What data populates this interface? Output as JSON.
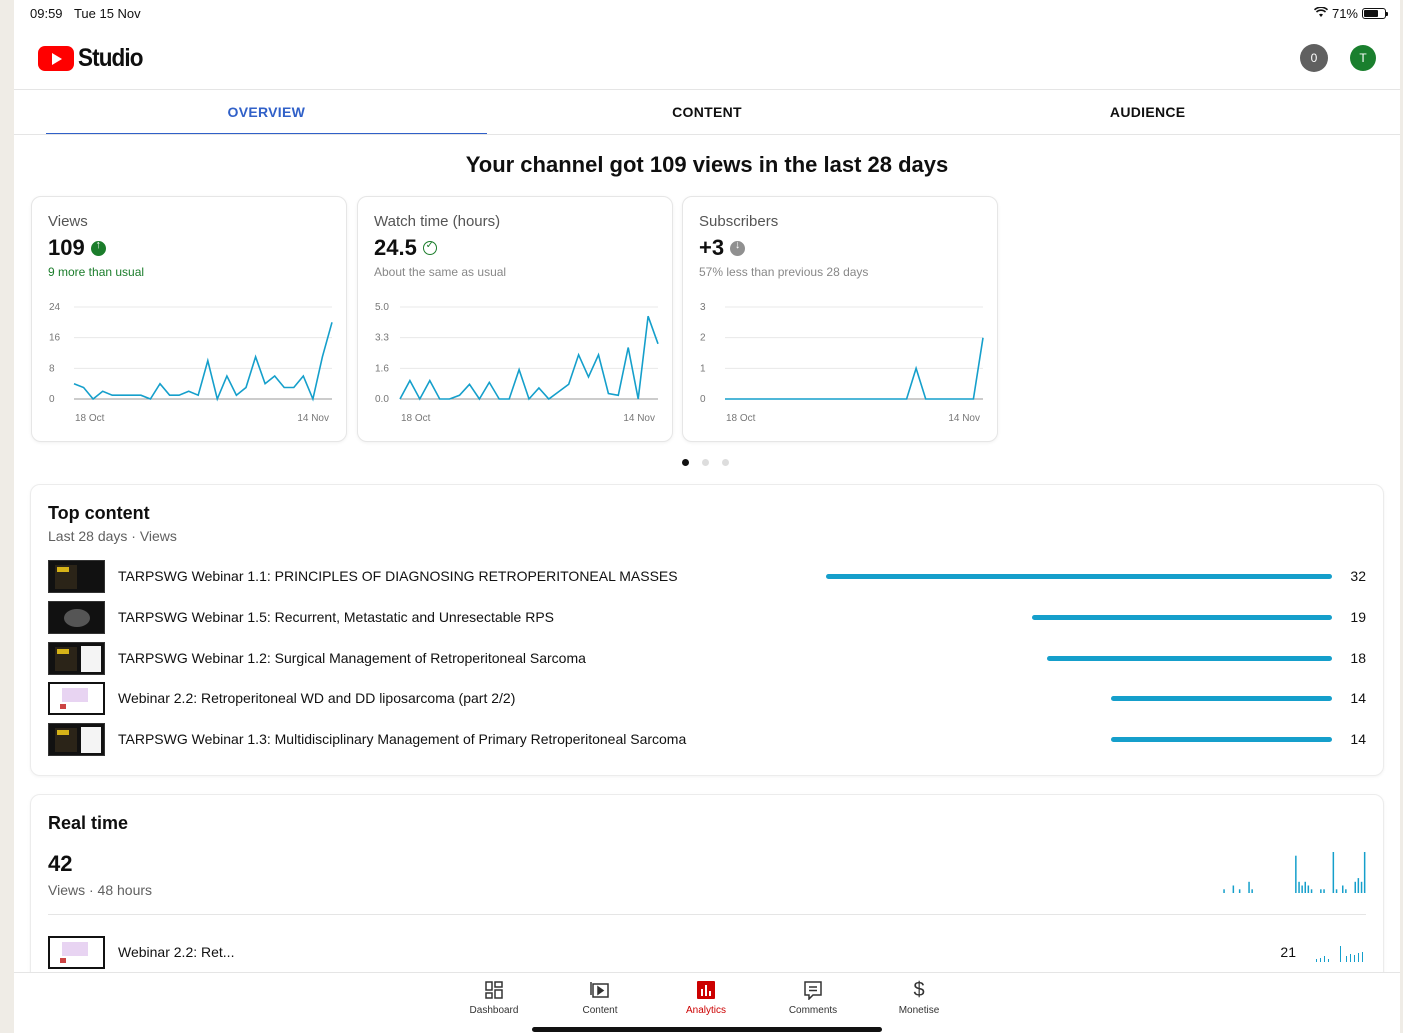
{
  "status_bar": {
    "time": "09:59",
    "date": "Tue 15 Nov",
    "battery": "71%"
  },
  "header": {
    "app_name": "Studio",
    "notification_count": "0",
    "avatar_initial": "T"
  },
  "tabs": [
    {
      "label": "OVERVIEW",
      "active": true
    },
    {
      "label": "CONTENT",
      "active": false
    },
    {
      "label": "AUDIENCE",
      "active": false
    }
  ],
  "headline": "Your channel got 109 views in the last 28 days",
  "metrics": [
    {
      "title": "Views",
      "value": "109",
      "trend": "up",
      "note": "9 more than usual",
      "chart_data": {
        "type": "line",
        "x_labels": [
          "18 Oct",
          "14 Nov"
        ],
        "y_ticks": [
          "24",
          "16",
          "8",
          "0"
        ],
        "ylim": [
          0,
          24
        ],
        "values": [
          4,
          3,
          0,
          2,
          1,
          1,
          1,
          1,
          0,
          4,
          1,
          1,
          2,
          1,
          10,
          0,
          6,
          1,
          3,
          11,
          4,
          6,
          3,
          3,
          6,
          0,
          11,
          20
        ]
      }
    },
    {
      "title": "Watch time (hours)",
      "value": "24.5",
      "trend": "same",
      "note": "About the same as usual",
      "chart_data": {
        "type": "line",
        "x_labels": [
          "18 Oct",
          "14 Nov"
        ],
        "y_ticks": [
          "5.0",
          "3.3",
          "1.6",
          "0.0"
        ],
        "ylim": [
          0,
          5
        ],
        "values": [
          0,
          1,
          0,
          1,
          0,
          0,
          0.2,
          0.8,
          0,
          0.9,
          0,
          0,
          1.6,
          0,
          0.6,
          0,
          0.4,
          0.8,
          2.4,
          1.2,
          2.4,
          0.3,
          0.2,
          2.8,
          0,
          4.5,
          3
        ]
      }
    },
    {
      "title": "Subscribers",
      "value": "+3",
      "trend": "down",
      "note": "57% less than previous 28 days",
      "chart_data": {
        "type": "line",
        "x_labels": [
          "18 Oct",
          "14 Nov"
        ],
        "y_ticks": [
          "3",
          "2",
          "1",
          "0"
        ],
        "ylim": [
          0,
          3
        ],
        "values": [
          0,
          0,
          0,
          0,
          0,
          0,
          0,
          0,
          0,
          0,
          0,
          0,
          0,
          0,
          0,
          0,
          0,
          0,
          0,
          0,
          1,
          0,
          0,
          0,
          0,
          0,
          0,
          2
        ]
      }
    }
  ],
  "carousel": {
    "pages": 3,
    "active": 0
  },
  "top_content": {
    "title": "Top content",
    "subtitle": "Last 28 days · Views",
    "max": 32,
    "items": [
      {
        "title": "TARPSWG Webinar 1.1: PRINCIPLES OF DIAGNOSING RETROPERITONEAL MASSES",
        "views": 32,
        "thumb": "dark"
      },
      {
        "title": "TARPSWG Webinar 1.5: Recurrent, Metastatic and Unresectable RPS",
        "views": 19,
        "thumb": "scan"
      },
      {
        "title": "TARPSWG Webinar 1.2: Surgical Management of Retroperitoneal Sarcoma",
        "views": 18,
        "thumb": "split"
      },
      {
        "title": "Webinar 2.2: Retroperitoneal WD and DD liposarcoma (part 2/2)",
        "views": 14,
        "thumb": "slide"
      },
      {
        "title": "TARPSWG Webinar 1.3: Multidisciplinary Management of Primary Retroperitoneal Sarcoma",
        "views": 14,
        "thumb": "split"
      }
    ]
  },
  "realtime": {
    "title": "Real time",
    "value": "42",
    "subtitle": "Views · 48 hours",
    "chart_data": {
      "type": "bar",
      "values": [
        0,
        0,
        1,
        0,
        0,
        2,
        0,
        1,
        0,
        0,
        3,
        1,
        0,
        0,
        0,
        0,
        0,
        0,
        0,
        0,
        0,
        0,
        0,
        0,
        0,
        10,
        3,
        2,
        3,
        2,
        1,
        0,
        0,
        1,
        1,
        0,
        0,
        11,
        1,
        0,
        2,
        1,
        0,
        0,
        3,
        4,
        3,
        11
      ]
    },
    "row": {
      "title": "Webinar 2.2: Ret...",
      "views": "21"
    }
  },
  "bottom_nav": [
    {
      "label": "Dashboard",
      "icon": "dashboard-icon",
      "active": false
    },
    {
      "label": "Content",
      "icon": "content-icon",
      "active": false
    },
    {
      "label": "Analytics",
      "icon": "analytics-icon",
      "active": true
    },
    {
      "label": "Comments",
      "icon": "comments-icon",
      "active": false
    },
    {
      "label": "Monetise",
      "icon": "monetise-icon",
      "active": false
    }
  ],
  "colors": {
    "accent": "#3060c8",
    "chart": "#159fcb",
    "positive": "#1b7d2b",
    "brand": "#ff0000",
    "nav_active": "#cc0000"
  }
}
